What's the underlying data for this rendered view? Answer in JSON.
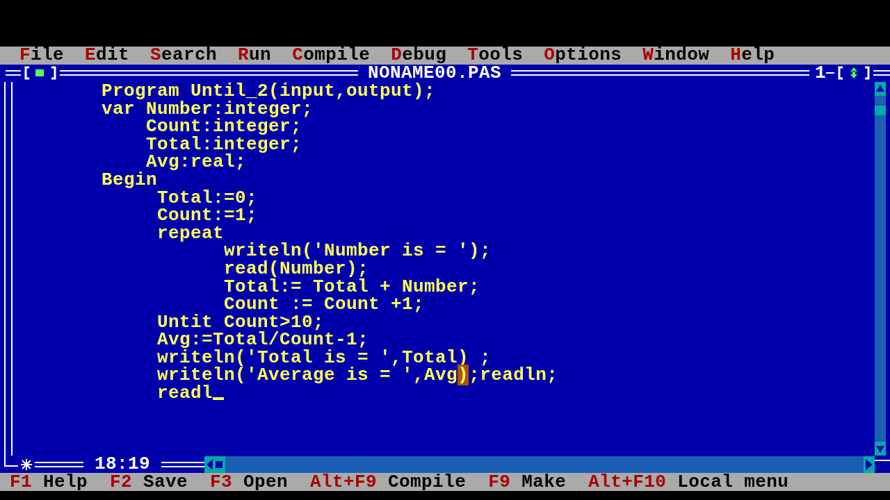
{
  "menu": [
    {
      "hotkey": "F",
      "rest": "ile"
    },
    {
      "hotkey": "E",
      "rest": "dit"
    },
    {
      "hotkey": "S",
      "rest": "earch"
    },
    {
      "hotkey": "R",
      "rest": "un"
    },
    {
      "hotkey": "C",
      "rest": "ompile"
    },
    {
      "hotkey": "D",
      "rest": "ebug"
    },
    {
      "hotkey": "T",
      "rest": "ools"
    },
    {
      "hotkey": "O",
      "rest": "ptions"
    },
    {
      "hotkey": "W",
      "rest": "indow"
    },
    {
      "hotkey": "H",
      "rest": "elp"
    }
  ],
  "window": {
    "title": "NONAME00.PAS",
    "number": "1",
    "modified": true,
    "position": "18:19"
  },
  "code_lines": [
    {
      "text": "        Program Until_2(input,output);",
      "cursor": false
    },
    {
      "text": "        var Number:integer;",
      "cursor": false
    },
    {
      "text": "            Count:integer;",
      "cursor": false
    },
    {
      "text": "            Total:integer;",
      "cursor": false
    },
    {
      "text": "            Avg:real;",
      "cursor": false
    },
    {
      "text": "        Begin",
      "cursor": false
    },
    {
      "text": "             Total:=0;",
      "cursor": false
    },
    {
      "text": "             Count:=1;",
      "cursor": false
    },
    {
      "text": "             repeat",
      "cursor": false
    },
    {
      "text": "                   writeln('Number is = ');",
      "cursor": false
    },
    {
      "text": "                   read(Number);",
      "cursor": false
    },
    {
      "text": "                   Total:= Total + Number;",
      "cursor": false
    },
    {
      "text": "                   Count := Count +1;",
      "cursor": false
    },
    {
      "text": "             Untit Count>10;",
      "cursor": false
    },
    {
      "text": "             Avg:=Total/Count-1;",
      "cursor": false
    },
    {
      "text": "             writeln('Total is = ',Total) ;",
      "cursor": false
    },
    {
      "text": "             writeln('Average is = ',Avg",
      "match": ")",
      "after": ";readln;",
      "cursor": false
    },
    {
      "text": "             readl",
      "cursor": true
    }
  ],
  "status_bar": [
    {
      "key": "F1",
      "label": "Help"
    },
    {
      "key": "F2",
      "label": "Save"
    },
    {
      "key": "F3",
      "label": "Open"
    },
    {
      "key": "Alt+F9",
      "label": "Compile"
    },
    {
      "key": "F9",
      "label": "Make"
    },
    {
      "key": "Alt+F10",
      "label": "Local menu"
    }
  ]
}
